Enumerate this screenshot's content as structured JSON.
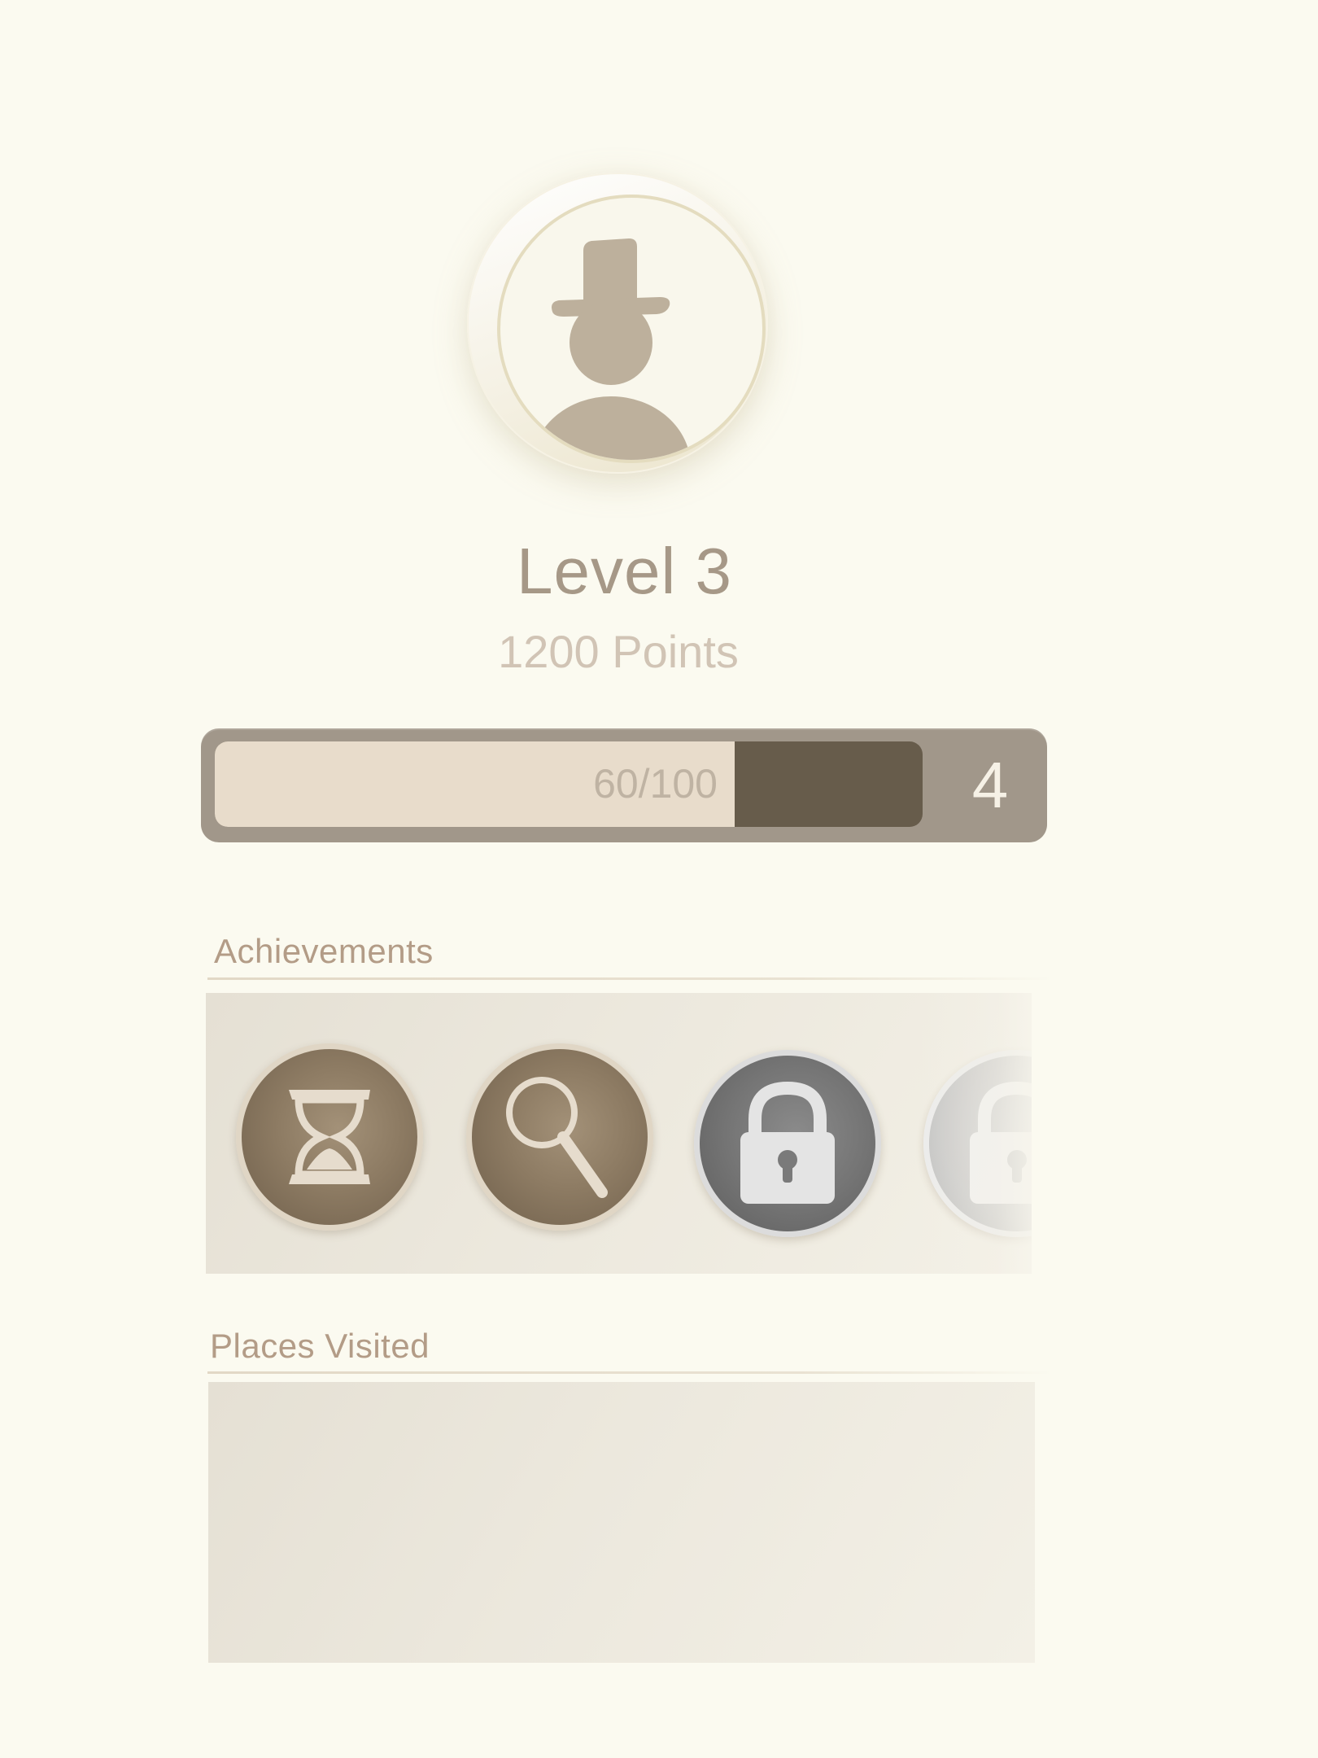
{
  "profile": {
    "avatar_icon": "top-hat-person-icon",
    "level_label": "Level 3",
    "points_label": "1200 Points"
  },
  "progress": {
    "label": "60/100",
    "current": 60,
    "max": 100,
    "next_level": "4"
  },
  "achievements": {
    "title": "Achievements",
    "badges": [
      {
        "icon": "hourglass-icon",
        "state": "unlocked"
      },
      {
        "icon": "magnifying-glass-icon",
        "state": "unlocked"
      },
      {
        "icon": "lock-icon",
        "state": "locked"
      },
      {
        "icon": "lock-icon",
        "state": "locked"
      }
    ]
  },
  "places": {
    "title": "Places Visited"
  },
  "colors": {
    "background": "#fbfaf0",
    "accent_brown": "#675c4b",
    "bar_frame": "#a1978a",
    "title_text": "#a69887"
  }
}
